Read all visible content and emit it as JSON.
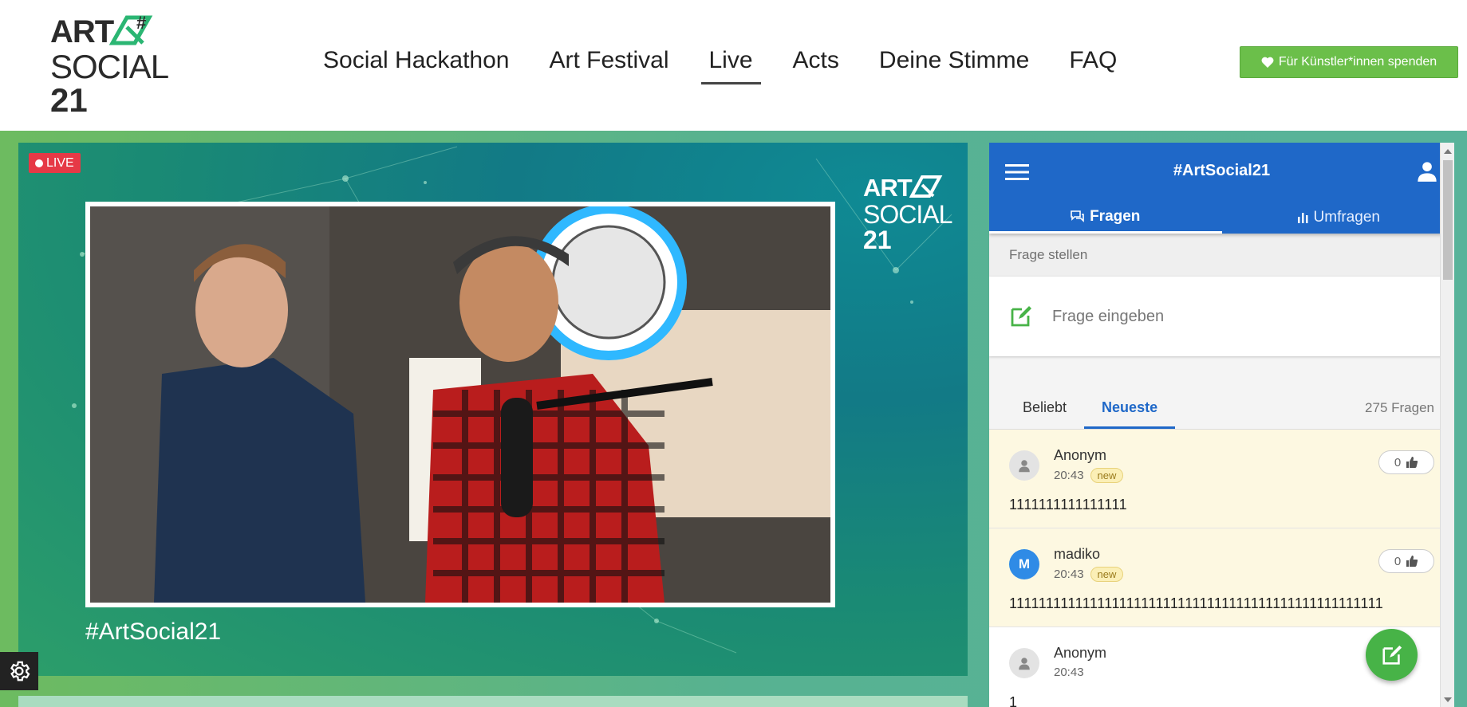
{
  "header": {
    "logo": {
      "line1": "ART",
      "line2": "SOCIAL",
      "line3": "21",
      "hash": "#"
    },
    "nav": [
      {
        "label": "Social Hackathon"
      },
      {
        "label": "Art Festival"
      },
      {
        "label": "Live",
        "active": true
      },
      {
        "label": "Acts"
      },
      {
        "label": "Deine Stimme"
      },
      {
        "label": "FAQ"
      }
    ],
    "donate_label": "Für Künstler*innen spenden",
    "donate_icon": "heart-icon"
  },
  "video": {
    "live_label": "LIVE",
    "logo": {
      "line1": "ART",
      "line2": "SOCIAL",
      "line3": "21"
    },
    "hashtag": "#ArtSocial21"
  },
  "panel": {
    "title": "#ArtSocial21",
    "tabs": [
      {
        "label": "Fragen",
        "icon": "chat-bubbles-icon",
        "active": true
      },
      {
        "label": "Umfragen",
        "icon": "bar-chart-icon"
      }
    ],
    "ask_label": "Frage stellen",
    "ask_placeholder": "Frage eingeben",
    "filters": [
      {
        "label": "Beliebt"
      },
      {
        "label": "Neueste",
        "active": true
      }
    ],
    "question_count": "275 Fragen",
    "questions": [
      {
        "author": "Anonym",
        "time": "20:43",
        "badge": "new",
        "votes": "0",
        "text": "1111111111111111",
        "avatar": ""
      },
      {
        "author": "madiko",
        "time": "20:43",
        "badge": "new",
        "votes": "0",
        "text": "111111111111111111111111111111111111111111111111111",
        "avatar": "M"
      },
      {
        "author": "Anonym",
        "time": "20:43",
        "badge": "",
        "votes": "",
        "text": "1",
        "avatar": ""
      }
    ]
  },
  "colors": {
    "primary_blue": "#1f68c8",
    "green": "#6bbf4a",
    "live_red": "#e63946",
    "new_bg": "#fdf8e1"
  }
}
